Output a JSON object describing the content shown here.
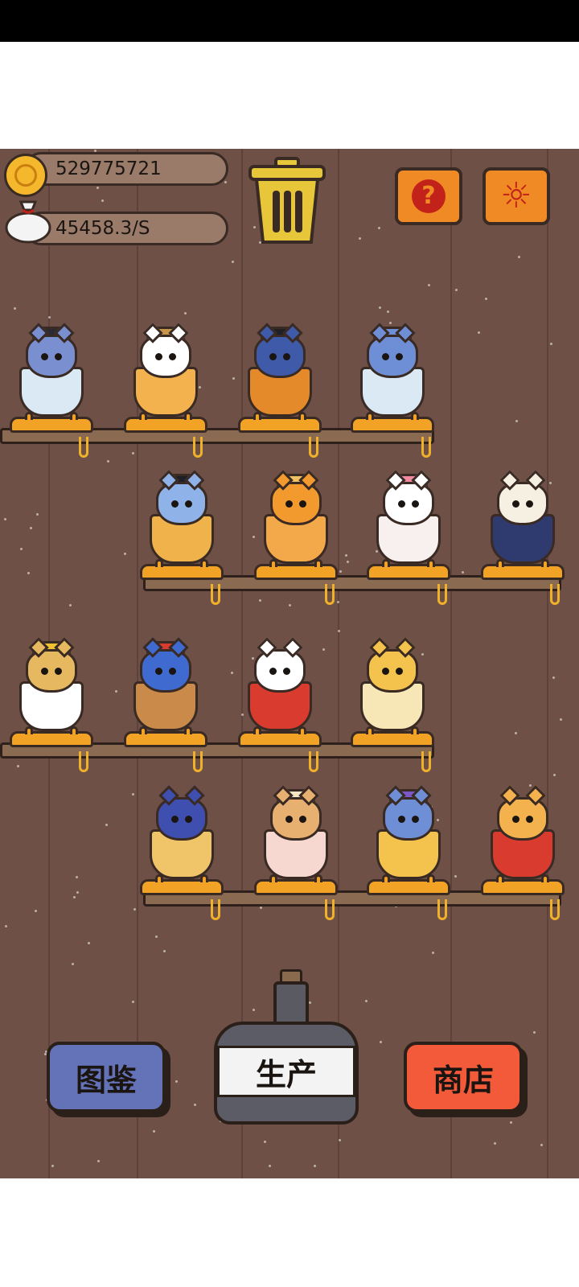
{
  "hud": {
    "coins": "529775721",
    "income_rate": "45458.3/S"
  },
  "buttons": {
    "help": "?",
    "settings": "☼",
    "collection": "图鉴",
    "produce": "生产",
    "shop": "商店"
  },
  "colors": {
    "background": "#6e5047",
    "cushion": "#f2a224",
    "orange_button": "#f08a25",
    "blue_button": "#6472b8",
    "red_button": "#f25a3a",
    "bottle": "#5c5c66"
  },
  "cats": [
    {
      "row": 1,
      "slot": 1,
      "fur": "#7a8fd0",
      "cup": "#dbe9f5",
      "hat": "top-hat"
    },
    {
      "row": 1,
      "slot": 2,
      "fur": "#ffffff",
      "cup": "#f3b24e",
      "hat": "cowboy-hat"
    },
    {
      "row": 1,
      "slot": 3,
      "fur": "#3f5aa8",
      "cup": "#e48a2a",
      "hat": "bicorne"
    },
    {
      "row": 1,
      "slot": 4,
      "fur": "#6e8fd6",
      "cup": "#dbe9f5",
      "hat": "ushanka"
    },
    {
      "row": 2,
      "slot": 1,
      "fur": "#8fb3e8",
      "cup": "#f0b24a",
      "hat": "pirate-hat"
    },
    {
      "row": 2,
      "slot": 2,
      "fur": "#f39a2f",
      "cup": "#f3a84a",
      "hat": "sombrero"
    },
    {
      "row": 2,
      "slot": 3,
      "fur": "#ffffff",
      "cup": "#f7f0ef",
      "hat": "flower"
    },
    {
      "row": 2,
      "slot": 4,
      "fur": "#f6f0e2",
      "cup": "#2f3a6e",
      "hat": "none"
    },
    {
      "row": 3,
      "slot": 1,
      "fur": "#e6b860",
      "cup": "#ffffff",
      "hat": "crown"
    },
    {
      "row": 3,
      "slot": 2,
      "fur": "#3f6ad0",
      "cup": "#c98a4a",
      "hat": "apple"
    },
    {
      "row": 3,
      "slot": 3,
      "fur": "#ffffff",
      "cup": "#d93b2f",
      "hat": "none"
    },
    {
      "row": 3,
      "slot": 4,
      "fur": "#f3c34e",
      "cup": "#f7e7b6",
      "hat": "none"
    },
    {
      "row": 4,
      "slot": 1,
      "fur": "#3f4fb0",
      "cup": "#f0c56a",
      "hat": "none"
    },
    {
      "row": 4,
      "slot": 2,
      "fur": "#e8b070",
      "cup": "#f7d8d0",
      "hat": "llama"
    },
    {
      "row": 4,
      "slot": 3,
      "fur": "#6e8fd6",
      "cup": "#f3c34e",
      "hat": "witch-hat"
    },
    {
      "row": 4,
      "slot": 4,
      "fur": "#f3b24e",
      "cup": "#d93b2f",
      "hat": "none"
    }
  ]
}
